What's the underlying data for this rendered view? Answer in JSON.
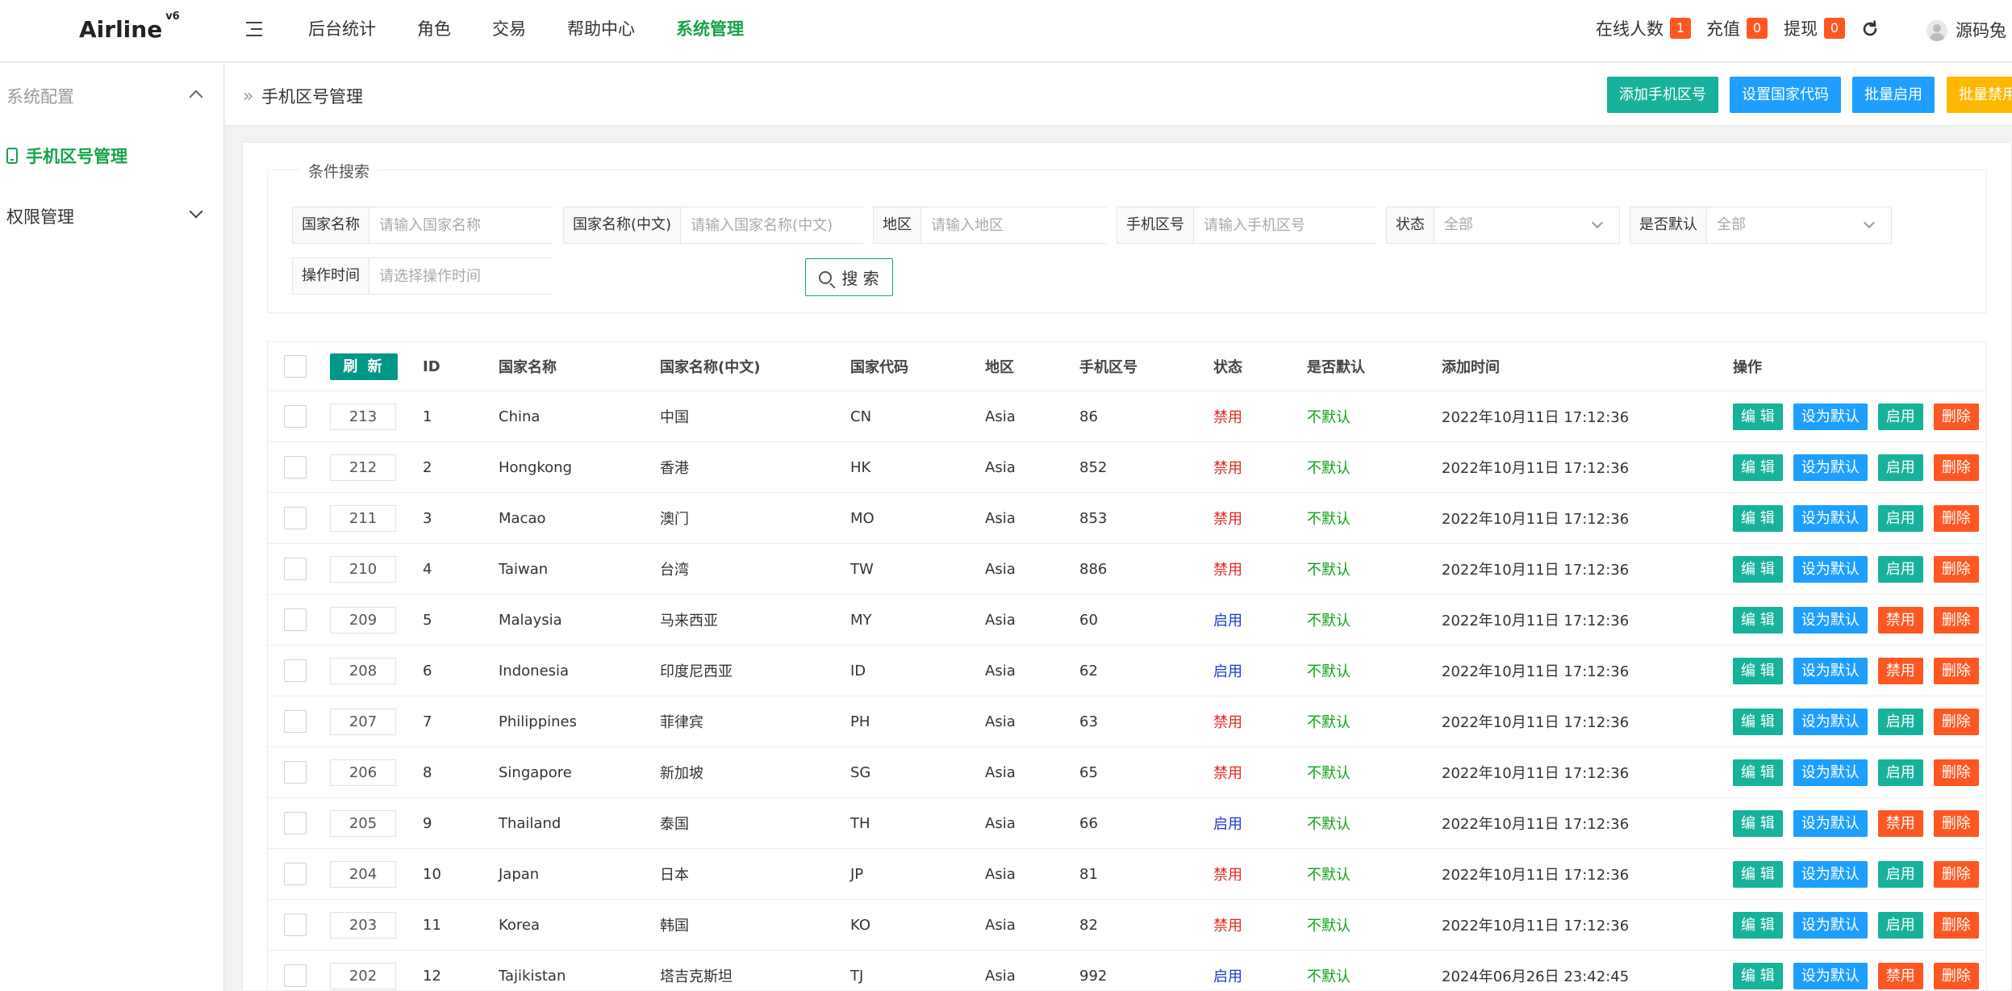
{
  "header": {
    "logo": "Airline",
    "logo_version": "v6",
    "nav": [
      "后台统计",
      "角色",
      "交易",
      "帮助中心",
      "系统管理"
    ],
    "active_nav_index": 4,
    "stats": [
      {
        "label": "在线人数",
        "count": "1"
      },
      {
        "label": "充值",
        "count": "0"
      },
      {
        "label": "提现",
        "count": "0"
      }
    ],
    "username": "源码兔"
  },
  "sidebar": {
    "group1": "系统配置",
    "active_item": "手机区号管理",
    "group2": "权限管理"
  },
  "breadcrumb": "手机区号管理",
  "actions": {
    "add": "添加手机区号",
    "set_code": "设置国家代码",
    "batch_enable": "批量启用",
    "batch_disable": "批量禁用"
  },
  "search": {
    "legend": "条件搜索",
    "country_label": "国家名称",
    "country_placeholder": "请输入国家名称",
    "country_cn_label": "国家名称(中文)",
    "country_cn_placeholder": "请输入国家名称(中文)",
    "region_label": "地区",
    "region_placeholder": "请输入地区",
    "phone_label": "手机区号",
    "phone_placeholder": "请输入手机区号",
    "status_label": "状态",
    "status_value": "全部",
    "default_label": "是否默认",
    "default_value": "全部",
    "time_label": "操作时间",
    "time_placeholder": "请选择操作时间",
    "button": "搜 索"
  },
  "table": {
    "refresh": "刷 新",
    "headers": [
      "ID",
      "国家名称",
      "国家名称(中文)",
      "国家代码",
      "地区",
      "手机区号",
      "状态",
      "是否默认",
      "添加时间",
      "操作"
    ],
    "action_labels": {
      "edit": "编 辑",
      "set_default": "设为默认",
      "enable": "启用",
      "disable": "禁用",
      "delete": "删除"
    },
    "rows": [
      {
        "sort": "213",
        "id": "1",
        "name": "China",
        "name_cn": "中国",
        "code": "CN",
        "region": "Asia",
        "phone": "86",
        "status": "禁用",
        "is_default": "不默认",
        "time": "2022年10月11日 17:12:36"
      },
      {
        "sort": "212",
        "id": "2",
        "name": "Hongkong",
        "name_cn": "香港",
        "code": "HK",
        "region": "Asia",
        "phone": "852",
        "status": "禁用",
        "is_default": "不默认",
        "time": "2022年10月11日 17:12:36"
      },
      {
        "sort": "211",
        "id": "3",
        "name": "Macao",
        "name_cn": "澳门",
        "code": "MO",
        "region": "Asia",
        "phone": "853",
        "status": "禁用",
        "is_default": "不默认",
        "time": "2022年10月11日 17:12:36"
      },
      {
        "sort": "210",
        "id": "4",
        "name": "Taiwan",
        "name_cn": "台湾",
        "code": "TW",
        "region": "Asia",
        "phone": "886",
        "status": "禁用",
        "is_default": "不默认",
        "time": "2022年10月11日 17:12:36"
      },
      {
        "sort": "209",
        "id": "5",
        "name": "Malaysia",
        "name_cn": "马来西亚",
        "code": "MY",
        "region": "Asia",
        "phone": "60",
        "status": "启用",
        "is_default": "不默认",
        "time": "2022年10月11日 17:12:36"
      },
      {
        "sort": "208",
        "id": "6",
        "name": "Indonesia",
        "name_cn": "印度尼西亚",
        "code": "ID",
        "region": "Asia",
        "phone": "62",
        "status": "启用",
        "is_default": "不默认",
        "time": "2022年10月11日 17:12:36"
      },
      {
        "sort": "207",
        "id": "7",
        "name": "Philippines",
        "name_cn": "菲律宾",
        "code": "PH",
        "region": "Asia",
        "phone": "63",
        "status": "禁用",
        "is_default": "不默认",
        "time": "2022年10月11日 17:12:36"
      },
      {
        "sort": "206",
        "id": "8",
        "name": "Singapore",
        "name_cn": "新加坡",
        "code": "SG",
        "region": "Asia",
        "phone": "65",
        "status": "禁用",
        "is_default": "不默认",
        "time": "2022年10月11日 17:12:36"
      },
      {
        "sort": "205",
        "id": "9",
        "name": "Thailand",
        "name_cn": "泰国",
        "code": "TH",
        "region": "Asia",
        "phone": "66",
        "status": "启用",
        "is_default": "不默认",
        "time": "2022年10月11日 17:12:36"
      },
      {
        "sort": "204",
        "id": "10",
        "name": "Japan",
        "name_cn": "日本",
        "code": "JP",
        "region": "Asia",
        "phone": "81",
        "status": "禁用",
        "is_default": "不默认",
        "time": "2022年10月11日 17:12:36"
      },
      {
        "sort": "203",
        "id": "11",
        "name": "Korea",
        "name_cn": "韩国",
        "code": "KO",
        "region": "Asia",
        "phone": "82",
        "status": "禁用",
        "is_default": "不默认",
        "time": "2022年10月11日 17:12:36"
      },
      {
        "sort": "202",
        "id": "12",
        "name": "Tajikistan",
        "name_cn": "塔吉克斯坦",
        "code": "TJ",
        "region": "Asia",
        "phone": "992",
        "status": "启用",
        "is_default": "不默认",
        "time": "2024年06月26日 23:42:45"
      }
    ]
  },
  "colors": {
    "accent_green": "#16a34a",
    "teal": "#17b29b",
    "blue": "#1e9fff",
    "red": "#ff5722",
    "orange": "#ffb800",
    "status_disabled": "#e0281f",
    "status_enabled": "#1d3ad6"
  },
  "icons": [
    "menu-toggle-icon",
    "refresh-icon",
    "avatar-icon",
    "chevron-up-icon",
    "chevron-down-icon",
    "phone-icon",
    "double-chevron-right-icon",
    "search-icon",
    "dropdown-arrow-icon"
  ]
}
